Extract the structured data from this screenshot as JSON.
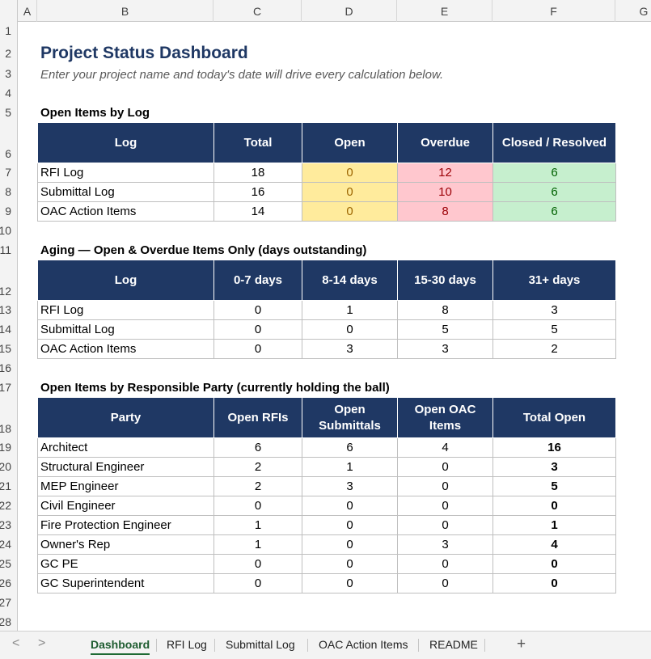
{
  "columns": [
    "A",
    "B",
    "C",
    "D",
    "E",
    "F",
    "G"
  ],
  "rows": [
    "1",
    "2",
    "3",
    "4",
    "5",
    "6",
    "7",
    "8",
    "9",
    "10",
    "11",
    "12",
    "13",
    "14",
    "15",
    "16",
    "17",
    "18",
    "19",
    "20",
    "21",
    "22",
    "23",
    "24",
    "25",
    "26",
    "27",
    "28"
  ],
  "title": "Project Status Dashboard",
  "subtitle": "Enter your project name and today's date will drive every calculation below.",
  "open_items": {
    "heading": "Open Items by Log",
    "headers": [
      "Log",
      "Total",
      "Open",
      "Overdue",
      "Closed / Resolved"
    ],
    "rows": [
      {
        "log": "RFI Log",
        "total": "18",
        "open": "0",
        "overdue": "12",
        "closed": "6"
      },
      {
        "log": "Submittal Log",
        "total": "16",
        "open": "0",
        "overdue": "10",
        "closed": "6"
      },
      {
        "log": "OAC Action Items",
        "total": "14",
        "open": "0",
        "overdue": "8",
        "closed": "6"
      }
    ],
    "colors": {
      "open_fill": "#ffeb9c",
      "overdue_fill": "#ffc7ce",
      "closed_fill": "#c6efce"
    }
  },
  "aging": {
    "heading": "Aging — Open & Overdue Items Only (days outstanding)",
    "headers": [
      "Log",
      "0-7 days",
      "8-14 days",
      "15-30 days",
      "31+ days"
    ],
    "rows": [
      {
        "log": "RFI Log",
        "d0_7": "0",
        "d8_14": "1",
        "d15_30": "8",
        "d31": "3"
      },
      {
        "log": "Submittal Log",
        "d0_7": "0",
        "d8_14": "0",
        "d15_30": "5",
        "d31": "5"
      },
      {
        "log": "OAC Action Items",
        "d0_7": "0",
        "d8_14": "3",
        "d15_30": "3",
        "d31": "2"
      }
    ]
  },
  "party": {
    "heading": "Open Items by Responsible Party (currently holding the ball)",
    "headers": [
      "Party",
      "Open RFIs",
      "Open Submittals",
      "Open OAC Items",
      "Total Open"
    ],
    "rows": [
      {
        "party": "Architect",
        "rfis": "6",
        "submittals": "6",
        "oac": "4",
        "total": "16"
      },
      {
        "party": "Structural Engineer",
        "rfis": "2",
        "submittals": "1",
        "oac": "0",
        "total": "3"
      },
      {
        "party": "MEP Engineer",
        "rfis": "2",
        "submittals": "3",
        "oac": "0",
        "total": "5"
      },
      {
        "party": "Civil Engineer",
        "rfis": "0",
        "submittals": "0",
        "oac": "0",
        "total": "0"
      },
      {
        "party": "Fire Protection Engineer",
        "rfis": "1",
        "submittals": "0",
        "oac": "0",
        "total": "1"
      },
      {
        "party": "Owner's Rep",
        "rfis": "1",
        "submittals": "0",
        "oac": "3",
        "total": "4"
      },
      {
        "party": "GC PE",
        "rfis": "0",
        "submittals": "0",
        "oac": "0",
        "total": "0"
      },
      {
        "party": "GC Superintendent",
        "rfis": "0",
        "submittals": "0",
        "oac": "0",
        "total": "0"
      }
    ]
  },
  "tabs": [
    {
      "label": "Dashboard",
      "active": true
    },
    {
      "label": "RFI Log",
      "active": false
    },
    {
      "label": "Submittal Log",
      "active": false
    },
    {
      "label": "OAC Action Items",
      "active": false
    },
    {
      "label": "README",
      "active": false
    }
  ],
  "nav": {
    "prev_icon": "chevron-left-icon",
    "next_icon": "chevron-right-icon",
    "add_icon": "plus-icon",
    "prev": "<",
    "next": ">",
    "add": "+"
  },
  "accent_color": "#1f3864"
}
